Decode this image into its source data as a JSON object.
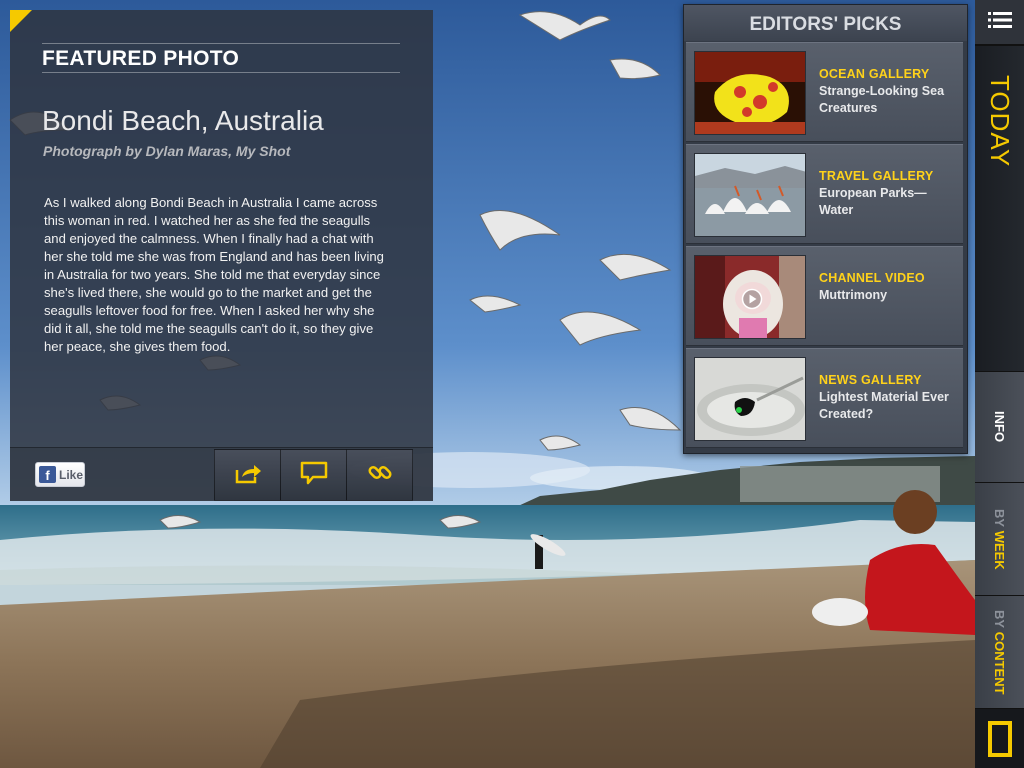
{
  "featured": {
    "heading": "FEATURED PHOTO",
    "title": "Bondi Beach, Australia",
    "credit": "Photograph by Dylan Maras, My Shot",
    "body": "As I walked along Bondi Beach in Australia I came across this woman in red. I watched her as she fed the seagulls and enjoyed the calmness. When I finally had a chat with her she told me she was from England and has been living in Australia for two years. She told me that everyday since she's lived there, she would go to the market and get the seagulls leftover food for free. When I asked her why she did it all, she told me the seagulls can't do it, so they give her peace, she gives them food.",
    "like_label": "Like",
    "toolbar": [
      "share-icon",
      "comment-icon",
      "link-icon"
    ]
  },
  "picks": {
    "heading": "EDITORS' PICKS",
    "items": [
      {
        "category": "OCEAN GALLERY",
        "title": "Strange-Looking Sea Creatures",
        "thumb": "frogfish"
      },
      {
        "category": "TRAVEL GALLERY",
        "title": "European Parks—Water",
        "thumb": "pelicans"
      },
      {
        "category": "CHANNEL VIDEO",
        "title": "Muttrimony",
        "thumb": "dog-video"
      },
      {
        "category": "NEWS GALLERY",
        "title": "Lightest Material Ever Created?",
        "thumb": "material"
      }
    ]
  },
  "sidebar": {
    "today": "TODAY",
    "info": "INFO",
    "by_week_prefix": "BY",
    "by_week": "WEEK",
    "by_content_prefix": "BY",
    "by_content": "CONTENT",
    "menu_icon": "list-menu-icon",
    "logo": "natgeo-yellow-border-logo"
  },
  "colors": {
    "accent": "#f5c900",
    "panel": "#2e3440",
    "fb_blue": "#3b5998"
  }
}
